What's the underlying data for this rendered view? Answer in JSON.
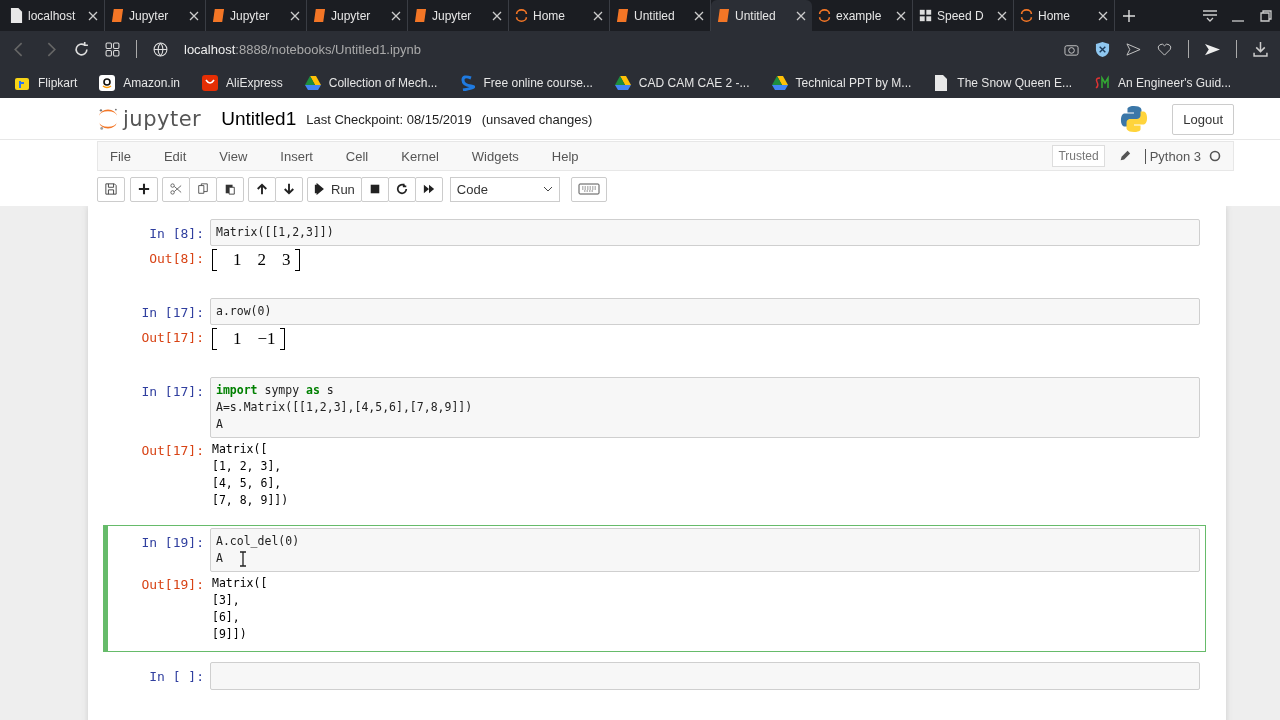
{
  "browser": {
    "tabs": [
      {
        "kind": "page",
        "title": "localhost",
        "selected": false
      },
      {
        "kind": "book",
        "title": "Jupyter",
        "selected": false
      },
      {
        "kind": "book",
        "title": "Jupyter",
        "selected": false
      },
      {
        "kind": "book",
        "title": "Jupyter",
        "selected": false
      },
      {
        "kind": "book",
        "title": "Jupyter",
        "selected": false
      },
      {
        "kind": "jupyter",
        "title": "Home",
        "selected": false
      },
      {
        "kind": "book",
        "title": "Untitled",
        "selected": false
      },
      {
        "kind": "book",
        "title": "Untitled",
        "selected": true
      },
      {
        "kind": "jupyter",
        "title": "example",
        "selected": false
      },
      {
        "kind": "grid",
        "title": "Speed D",
        "selected": false
      },
      {
        "kind": "jupyter",
        "title": "Home",
        "selected": false
      }
    ],
    "address": {
      "host": "localhost",
      "path": ":8888/notebooks/Untitled1.ipynb"
    },
    "bookmarks": [
      {
        "kind": "flipkart",
        "label": "Flipkart"
      },
      {
        "kind": "amazon",
        "label": "Amazon.in"
      },
      {
        "kind": "aliexpress",
        "label": "AliExpress"
      },
      {
        "kind": "drive",
        "label": "Collection of Mech..."
      },
      {
        "kind": "s",
        "label": "Free online course..."
      },
      {
        "kind": "drive",
        "label": "CAD CAM CAE 2 -..."
      },
      {
        "kind": "drive",
        "label": "Technical PPT by M..."
      },
      {
        "kind": "page",
        "label": "The Snow Queen E..."
      },
      {
        "kind": "sm",
        "label": "An Engineer's Guid..."
      }
    ]
  },
  "header": {
    "logo_text": "jupyter",
    "notebook_name": "Untitled1",
    "checkpoint": "Last Checkpoint: 08/15/2019",
    "autosave": "(unsaved changes)",
    "logout": "Logout"
  },
  "menu": {
    "items": [
      "File",
      "Edit",
      "View",
      "Insert",
      "Cell",
      "Kernel",
      "Widgets",
      "Help"
    ],
    "trusted": "Trusted",
    "kernel": "Python 3"
  },
  "toolbar": {
    "run": "Run",
    "cell_type": "Code"
  },
  "cells": [
    {
      "selected": false,
      "prompt": "In [8]:",
      "code": [
        "Matrix([[1,2,3]])"
      ],
      "out_prompt": "Out[8]:",
      "output": {
        "kind": "math",
        "entries": [
          "1",
          "2",
          "3"
        ]
      }
    },
    {
      "selected": false,
      "prompt": "In [17]:",
      "code": [
        "a.row(0)"
      ],
      "out_prompt": "Out[17]:",
      "output": {
        "kind": "math",
        "entries": [
          "1",
          "−1"
        ]
      }
    },
    {
      "selected": false,
      "prompt": "In [17]:",
      "code": [
        "**import** sympy **as** s",
        "A=s.Matrix([[1,2,3],[4,5,6],[7,8,9]])",
        "A"
      ],
      "out_prompt": "Out[17]:",
      "output": {
        "kind": "text",
        "lines": [
          "Matrix([",
          "[1, 2, 3],",
          "[4, 5, 6],",
          "[7, 8, 9]])"
        ]
      }
    },
    {
      "selected": true,
      "prompt": "In [19]:",
      "code": [
        "A.col_del(0)",
        "A"
      ],
      "out_prompt": "Out[19]:",
      "output": {
        "kind": "text",
        "lines": [
          "Matrix([",
          "[3],",
          "[6],",
          "[9]])"
        ]
      }
    },
    {
      "selected": false,
      "prompt": "In [ ]:"
    }
  ]
}
